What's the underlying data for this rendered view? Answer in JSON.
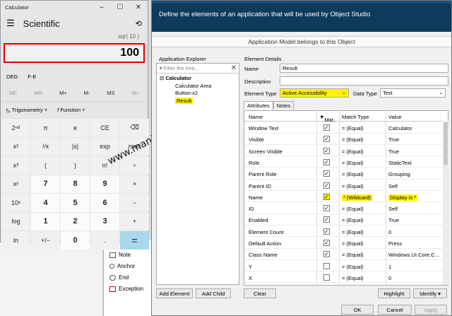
{
  "calculator": {
    "title": "Calculator",
    "window_buttons": [
      "–",
      "☐",
      "✕"
    ],
    "mode": "Scientific",
    "expression": "sqr( 10 )",
    "display": "100",
    "angle": [
      "DEG",
      "F-E"
    ],
    "memory": [
      "MC",
      "MR",
      "M+",
      "M-",
      "MS",
      "M˅"
    ],
    "functions": [
      "Trigonometry ˅",
      "Function ˅"
    ],
    "keys": [
      "2ⁿᵈ",
      "π",
      "e",
      "CE",
      "⌫",
      "x²",
      "¹⁄x",
      "|x|",
      "exp",
      "mod",
      "x³",
      "(",
      ")",
      "n!",
      "÷",
      "xʸ",
      "7",
      "8",
      "9",
      "×",
      "10ˣ",
      "4",
      "5",
      "6",
      "−",
      "log",
      "1",
      "2",
      "3",
      "+",
      "ln",
      "+/−",
      "0",
      ".",
      "="
    ]
  },
  "watermark": "www.manishsharma.dev",
  "background_stencils": [
    "Note",
    "Anchor",
    "End",
    "Exception"
  ],
  "dialog": {
    "title": "Define the elements of an application that will be used by Object Studio",
    "model_bar": "Application Model belongs to this Object",
    "explorer_label": "Application Explorer",
    "filter_placeholder": "Filter the tree...",
    "tree": {
      "root": "Calculator",
      "children": [
        "Calculator Area",
        "Button-x2",
        "Result"
      ]
    },
    "add_element": "Add Element",
    "add_child": "Add Child",
    "details_label": "Element Details",
    "name_label": "Name",
    "name_value": "Result",
    "description_label": "Description",
    "element_type_label": "Element Type",
    "element_type_value": "Active Accessibility",
    "data_type_label": "Data Type",
    "data_type_value": "Text",
    "tabs": [
      "Attributes",
      "Notes"
    ],
    "columns": [
      "Name",
      "Mat..",
      "Match Type",
      "Value"
    ],
    "attributes": [
      {
        "name": "Window Text",
        "checked": true,
        "match": "= (Equal)",
        "value": "Calculator"
      },
      {
        "name": "Visible",
        "checked": true,
        "match": "= (Equal)",
        "value": "True"
      },
      {
        "name": "Screen Visible",
        "checked": true,
        "match": "= (Equal)",
        "value": "True"
      },
      {
        "name": "Role",
        "checked": true,
        "match": "= (Equal)",
        "value": "StaticText"
      },
      {
        "name": "Parent Role",
        "checked": true,
        "match": "= (Equal)",
        "value": "Grouping"
      },
      {
        "name": "Parent ID",
        "checked": true,
        "match": "= (Equal)",
        "value": "Self"
      },
      {
        "name": "Name",
        "checked": true,
        "match": "* (Wildcard)",
        "value": "Display is *",
        "highlight": true
      },
      {
        "name": "ID",
        "checked": true,
        "match": "= (Equal)",
        "value": "Self"
      },
      {
        "name": "Enabled",
        "checked": true,
        "match": "= (Equal)",
        "value": "True"
      },
      {
        "name": "Element Count",
        "checked": true,
        "match": "= (Equal)",
        "value": "0"
      },
      {
        "name": "Default Action",
        "checked": true,
        "match": "= (Equal)",
        "value": "Press"
      },
      {
        "name": "Class Name",
        "checked": true,
        "match": "= (Equal)",
        "value": "Windows.UI.Core.C..."
      },
      {
        "name": "Y",
        "checked": false,
        "match": "= (Equal)",
        "value": "1"
      },
      {
        "name": "X",
        "checked": false,
        "match": "= (Equal)",
        "value": "0"
      }
    ],
    "clear": "Clear",
    "highlight": "Highlight",
    "identify": "Identify",
    "ok": "OK",
    "cancel": "Cancel",
    "apply": "Apply"
  },
  "colors": {
    "header": "#0e3a5c",
    "highlight": "#fff200",
    "result_border": "#e00000",
    "equals_key": "#a8d8ec"
  }
}
